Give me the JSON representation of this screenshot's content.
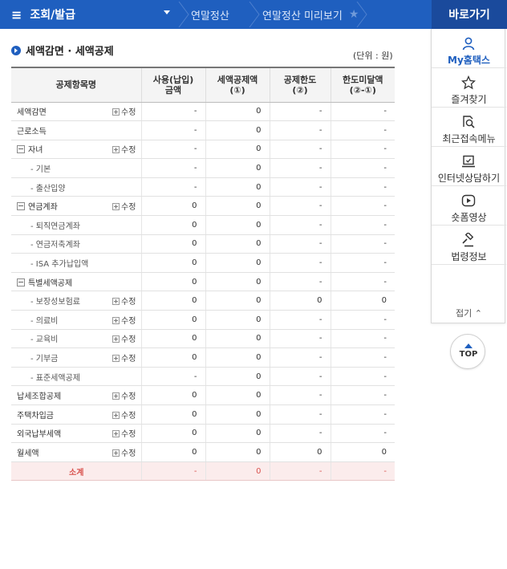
{
  "header": {
    "menu_label": "조회/발급",
    "breadcrumbs": [
      "연말정산",
      "연말정산 미리보기"
    ],
    "goto_label": "바로가기"
  },
  "section": {
    "title": "세액감면 · 세액공제",
    "unit": "(단위 : 원)"
  },
  "table": {
    "headers": [
      "공제항목명",
      "사용(납입)\n금액",
      "세액공제액\n(①)",
      "공제한도\n(②)",
      "한도미달액\n(②-①)"
    ],
    "rows": [
      {
        "name": "세액감면",
        "edit": "수정",
        "level": "top",
        "toggle": false,
        "values": [
          "-",
          "0",
          "-",
          "-"
        ]
      },
      {
        "name": "근로소득",
        "edit": "",
        "level": "top",
        "toggle": false,
        "values": [
          "-",
          "0",
          "-",
          "-"
        ]
      },
      {
        "name": "자녀",
        "edit": "수정",
        "level": "top",
        "toggle": true,
        "values": [
          "-",
          "0",
          "-",
          "-"
        ]
      },
      {
        "name": "- 기본",
        "edit": "",
        "level": "sub",
        "toggle": false,
        "values": [
          "-",
          "0",
          "-",
          "-"
        ]
      },
      {
        "name": "- 출산입양",
        "edit": "",
        "level": "sub",
        "toggle": false,
        "values": [
          "-",
          "0",
          "-",
          "-"
        ]
      },
      {
        "name": "연금계좌",
        "edit": "수정",
        "level": "top",
        "toggle": true,
        "values": [
          "0",
          "0",
          "-",
          "-"
        ]
      },
      {
        "name": "- 퇴직연금계좌",
        "edit": "",
        "level": "sub",
        "toggle": false,
        "values": [
          "0",
          "0",
          "-",
          "-"
        ]
      },
      {
        "name": "- 연금저축계좌",
        "edit": "",
        "level": "sub",
        "toggle": false,
        "values": [
          "0",
          "0",
          "-",
          "-"
        ]
      },
      {
        "name": "- ISA 추가납입액",
        "edit": "",
        "level": "sub",
        "toggle": false,
        "values": [
          "0",
          "0",
          "-",
          "-"
        ]
      },
      {
        "name": "특별세액공제",
        "edit": "",
        "level": "top",
        "toggle": true,
        "values": [
          "0",
          "0",
          "-",
          "-"
        ]
      },
      {
        "name": "- 보장성보험료",
        "edit": "수정",
        "level": "sub",
        "toggle": false,
        "values": [
          "0",
          "0",
          "0",
          "0"
        ]
      },
      {
        "name": "- 의료비",
        "edit": "수정",
        "level": "sub",
        "toggle": false,
        "values": [
          "0",
          "0",
          "-",
          "-"
        ]
      },
      {
        "name": "- 교육비",
        "edit": "수정",
        "level": "sub",
        "toggle": false,
        "values": [
          "0",
          "0",
          "-",
          "-"
        ]
      },
      {
        "name": "- 기부금",
        "edit": "수정",
        "level": "sub",
        "toggle": false,
        "values": [
          "0",
          "0",
          "-",
          "-"
        ]
      },
      {
        "name": "- 표준세액공제",
        "edit": "",
        "level": "sub",
        "toggle": false,
        "values": [
          "-",
          "0",
          "-",
          "-"
        ]
      },
      {
        "name": "납세조합공제",
        "edit": "수정",
        "level": "top",
        "toggle": false,
        "values": [
          "0",
          "0",
          "-",
          "-"
        ]
      },
      {
        "name": "주택차입금",
        "edit": "수정",
        "level": "top",
        "toggle": false,
        "values": [
          "0",
          "0",
          "-",
          "-"
        ]
      },
      {
        "name": "외국납부세액",
        "edit": "수정",
        "level": "top",
        "toggle": false,
        "values": [
          "0",
          "0",
          "-",
          "-"
        ]
      },
      {
        "name": "월세액",
        "edit": "수정",
        "level": "top",
        "toggle": false,
        "values": [
          "0",
          "0",
          "0",
          "0"
        ]
      }
    ],
    "total": {
      "name": "소계",
      "values": [
        "-",
        "0",
        "-",
        "-"
      ]
    }
  },
  "quick_menu": {
    "items": [
      {
        "label": "My홈택스",
        "icon": "person-icon"
      },
      {
        "label": "즐겨찾기",
        "icon": "star-icon"
      },
      {
        "label": "최근접속메뉴",
        "icon": "recent-search-icon"
      },
      {
        "label": "인터넷상담하기",
        "icon": "laptop-check-icon"
      },
      {
        "label": "숏폼영상",
        "icon": "play-icon"
      },
      {
        "label": "법령정보",
        "icon": "gavel-icon"
      }
    ],
    "fold_label": "접기",
    "top_label": "TOP"
  },
  "colors": {
    "brand": "#1f5fbf",
    "brand_dark": "#1a4a9c",
    "total_text": "#d9534f",
    "total_bg": "#fbecec"
  }
}
